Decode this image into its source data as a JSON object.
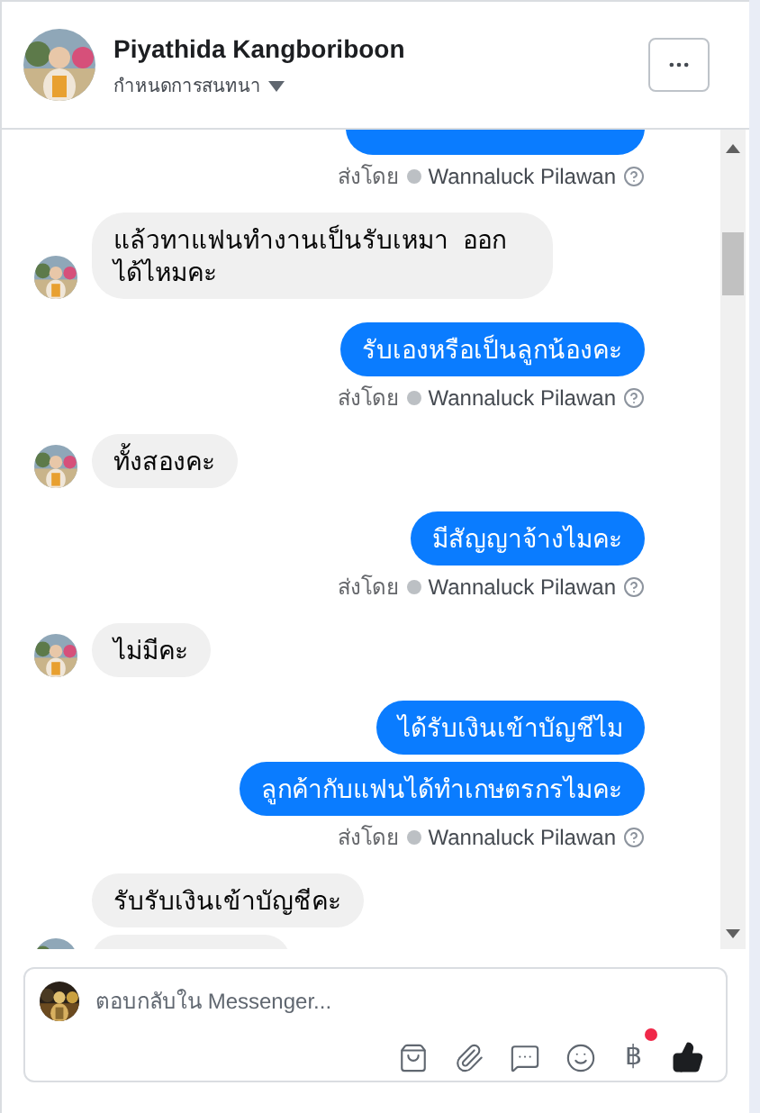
{
  "header": {
    "name": "Piyathida Kangboriboon",
    "subtitle": "กำหนดการสนทนา"
  },
  "messages": [
    {
      "kind": "outgoing_cut"
    },
    {
      "kind": "caption",
      "prefix": "ส่งโดย",
      "sender": "Wannaluck Pilawan"
    },
    {
      "kind": "incoming",
      "text": "แล้วทาแฟนทำงานเป็นรับเหมา  ออกได้ไหมคะ",
      "avatar": true
    },
    {
      "kind": "outgoing",
      "text": "รับเองหรือเป็นลูกน้องคะ"
    },
    {
      "kind": "caption",
      "prefix": "ส่งโดย",
      "sender": "Wannaluck Pilawan"
    },
    {
      "kind": "incoming",
      "text": "ทั้งสองคะ",
      "avatar": true
    },
    {
      "kind": "outgoing",
      "text": "มีสัญญาจ้างไมคะ"
    },
    {
      "kind": "caption",
      "prefix": "ส่งโดย",
      "sender": "Wannaluck Pilawan"
    },
    {
      "kind": "incoming",
      "text": "ไม่มีคะ",
      "avatar": true
    },
    {
      "kind": "outgoing",
      "text": "ได้รับเงินเข้าบัญชีไม"
    },
    {
      "kind": "outgoing",
      "text": "ลูกค้ากับแฟนได้ทำเกษตรกรไมคะ"
    },
    {
      "kind": "caption",
      "prefix": "ส่งโดย",
      "sender": "Wannaluck Pilawan"
    },
    {
      "kind": "incoming",
      "text": "รับรับเงินเข้าบัญชีคะ",
      "avatar": false
    },
    {
      "kind": "incoming_cut"
    }
  ],
  "composer": {
    "placeholder": "ตอบกลับใน Messenger...",
    "currency": "฿",
    "currency_badge": true
  }
}
